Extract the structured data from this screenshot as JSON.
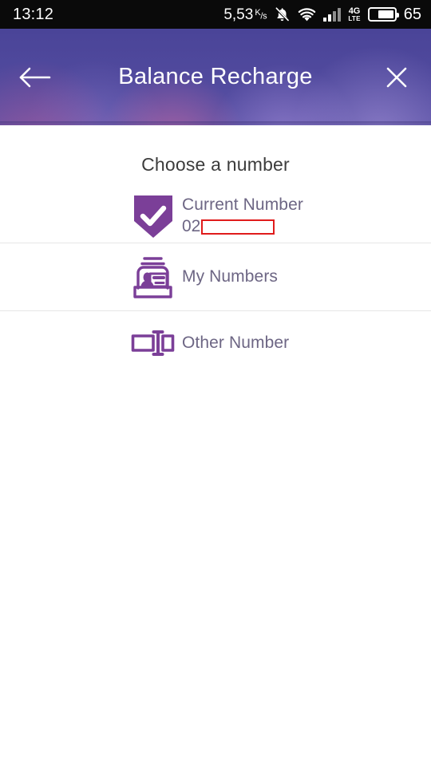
{
  "statusbar": {
    "clock": "13:12",
    "network_speed": "5,53",
    "network_speed_unit_num": "K",
    "network_speed_unit_den": "s",
    "mute_icon": "bell-muted-icon",
    "wifi_icon": "wifi-icon",
    "signal_icon": "signal-bars-icon",
    "network_type_primary": "4G",
    "network_type_secondary": "LTE",
    "battery_icon": "battery-icon",
    "battery_percent": "65"
  },
  "header": {
    "title": "Balance Recharge",
    "back_icon": "back-arrow-icon",
    "close_icon": "close-icon",
    "background_color": "#4a4498"
  },
  "main": {
    "page_title": "Choose a number",
    "options": [
      {
        "id": "current-number",
        "icon": "shield-check-icon",
        "label": "Current Number",
        "number_prefix": "02",
        "number_redacted": true,
        "selected": true
      },
      {
        "id": "my-numbers",
        "icon": "card-holder-icon",
        "label": "My Numbers",
        "selected": false
      },
      {
        "id": "other-number",
        "icon": "number-field-icon",
        "label": "Other Number",
        "selected": false
      }
    ]
  },
  "colors": {
    "accent_purple": "#7b3f98",
    "header_purple": "#4a4498",
    "label_text": "#6d6684",
    "title_text": "#3c3c3c",
    "redaction_border": "#e01b1b",
    "divider": "#e6e6e6"
  }
}
